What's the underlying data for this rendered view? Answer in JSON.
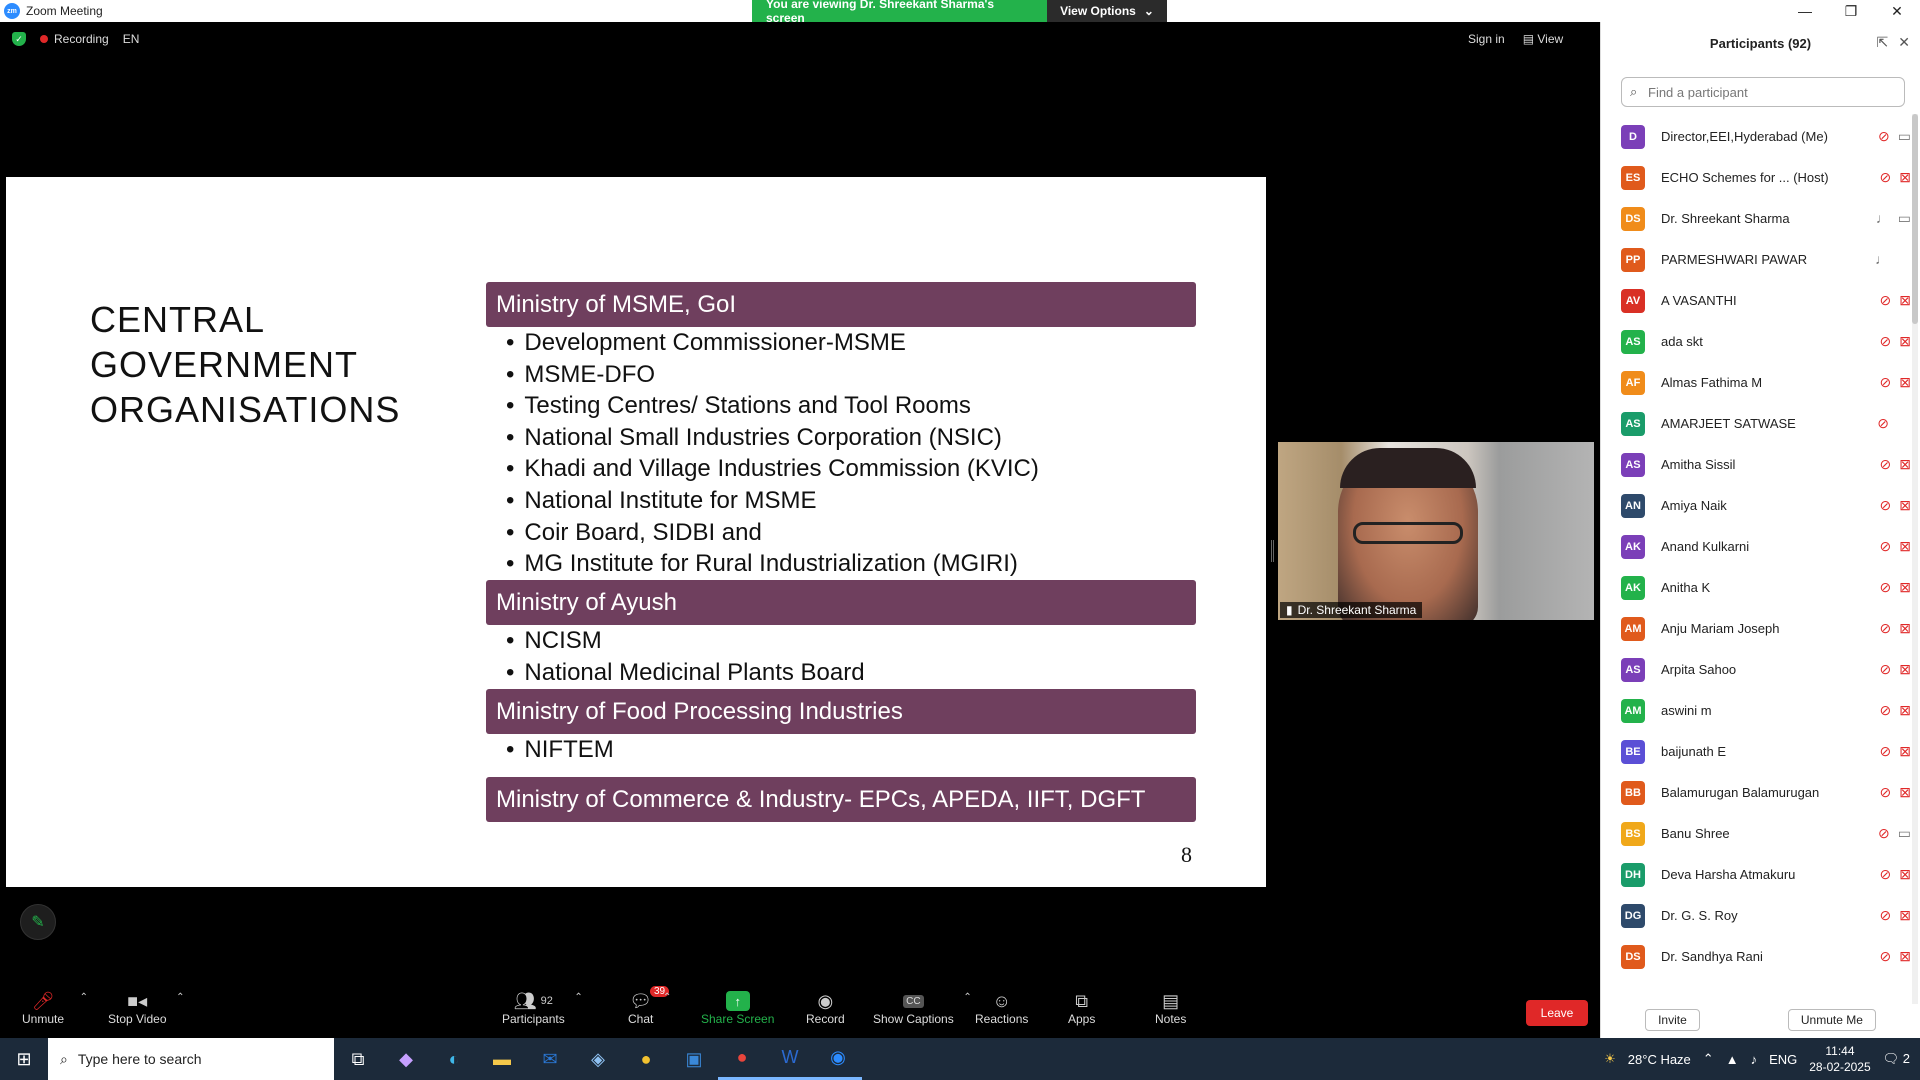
{
  "window": {
    "title": "Zoom Meeting",
    "viewing_banner": "You are viewing Dr. Shreekant Sharma's screen",
    "view_options": "View Options"
  },
  "meeting": {
    "recording": "Recording",
    "language": "EN",
    "sign_in": "Sign in",
    "view": "View"
  },
  "slide": {
    "title_line1": "CENTRAL GOVERNMENT",
    "title_line2": "ORGANISATIONS",
    "sections": [
      {
        "heading": "Ministry of MSME, GoI",
        "items": [
          "Development Commissioner-MSME",
          "MSME-DFO",
          "Testing Centres/ Stations and Tool Rooms",
          "National Small Industries Corporation (NSIC)",
          "Khadi and Village Industries Commission (KVIC)",
          "National Institute for MSME",
          "Coir Board, SIDBI and",
          "MG Institute for Rural Industrialization (MGIRI)"
        ]
      },
      {
        "heading": "Ministry of Ayush",
        "items": [
          "NCISM",
          "National Medicinal Plants Board"
        ]
      },
      {
        "heading": "Ministry of Food Processing Industries",
        "items": [
          "NIFTEM"
        ]
      },
      {
        "heading": "Ministry of Commerce & Industry- EPCs, APEDA, IIFT, DGFT",
        "items": []
      }
    ],
    "page_number": "8"
  },
  "video": {
    "speaker_name": "Dr. Shreekant Sharma"
  },
  "toolbar": {
    "unmute": "Unmute",
    "stop_video": "Stop Video",
    "participants": "Participants",
    "participants_count": "92",
    "chat": "Chat",
    "chat_badge": "39",
    "share_screen": "Share Screen",
    "record": "Record",
    "show_captions": "Show Captions",
    "reactions": "Reactions",
    "apps": "Apps",
    "notes": "Notes",
    "leave": "Leave"
  },
  "panel": {
    "title": "Participants (92)",
    "search_placeholder": "Find a participant",
    "invite": "Invite",
    "unmute_me": "Unmute Me",
    "participants": [
      {
        "initials": "D",
        "name": "Director,EEI,Hyderabad (Me)",
        "color": "#7b3fb8",
        "mic": "off",
        "cam": "on"
      },
      {
        "initials": "ES",
        "name": "ECHO Schemes for ... (Host)",
        "color": "#e05a1c",
        "mic": "off",
        "cam": "off"
      },
      {
        "initials": "DS",
        "name": "Dr. Shreekant Sharma",
        "color": "#f08c1a",
        "mic": "on",
        "cam": "on"
      },
      {
        "initials": "PP",
        "name": "PARMESHWARI PAWAR",
        "color": "#e05a1c",
        "mic": "on",
        "cam": "none"
      },
      {
        "initials": "AV",
        "name": "A VASANTHI",
        "color": "#d93025",
        "mic": "off",
        "cam": "off"
      },
      {
        "initials": "AS",
        "name": "ada skt",
        "color": "#23b24b",
        "mic": "off",
        "cam": "off"
      },
      {
        "initials": "AF",
        "name": "Almas Fathima M",
        "color": "#f08c1a",
        "mic": "off",
        "cam": "off"
      },
      {
        "initials": "AS",
        "name": "AMARJEET SATWASE",
        "color": "#1a9c6a",
        "mic": "off",
        "cam": "none"
      },
      {
        "initials": "AS",
        "name": "Amitha Sissil",
        "color": "#7b3fb8",
        "mic": "off",
        "cam": "off"
      },
      {
        "initials": "AN",
        "name": "Amiya Naik",
        "color": "#2e4a6b",
        "mic": "off",
        "cam": "off"
      },
      {
        "initials": "AK",
        "name": "Anand Kulkarni",
        "color": "#7b3fb8",
        "mic": "off",
        "cam": "off"
      },
      {
        "initials": "AK",
        "name": "Anitha K",
        "color": "#23b24b",
        "mic": "off",
        "cam": "off"
      },
      {
        "initials": "AM",
        "name": "Anju Mariam Joseph",
        "color": "#e05a1c",
        "mic": "off",
        "cam": "off"
      },
      {
        "initials": "AS",
        "name": "Arpita Sahoo",
        "color": "#7b3fb8",
        "mic": "off",
        "cam": "off"
      },
      {
        "initials": "AM",
        "name": "aswini m",
        "color": "#23b24b",
        "mic": "off",
        "cam": "off"
      },
      {
        "initials": "BE",
        "name": "baijunath E",
        "color": "#5b4fd6",
        "mic": "off",
        "cam": "off"
      },
      {
        "initials": "BB",
        "name": "Balamurugan Balamurugan",
        "color": "#e05a1c",
        "mic": "off",
        "cam": "off"
      },
      {
        "initials": "BS",
        "name": "Banu Shree",
        "color": "#f0a81a",
        "mic": "off",
        "cam": "on"
      },
      {
        "initials": "DH",
        "name": "Deva Harsha Atmakuru",
        "color": "#1a9c6a",
        "mic": "off",
        "cam": "off"
      },
      {
        "initials": "DG",
        "name": "Dr. G. S. Roy",
        "color": "#2e4a6b",
        "mic": "off",
        "cam": "off"
      },
      {
        "initials": "DS",
        "name": "Dr. Sandhya Rani",
        "color": "#e05a1c",
        "mic": "off",
        "cam": "off"
      }
    ]
  },
  "taskbar": {
    "search_placeholder": "Type here to search",
    "weather": "28°C  Haze",
    "lang": "ENG",
    "time": "11:44",
    "date": "28-02-2025",
    "notifications": "2"
  }
}
